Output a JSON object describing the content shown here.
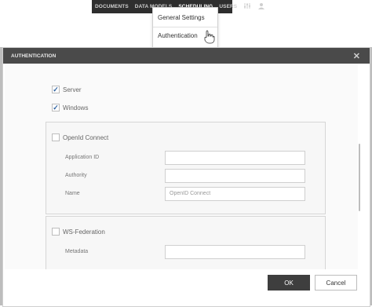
{
  "topnav": {
    "items": [
      "DOCUMENTS",
      "DATA MODELS",
      "SCHEDULING",
      "USERS"
    ],
    "active": "SCHEDULING",
    "icons": [
      "sliders-icon",
      "user-icon"
    ]
  },
  "dropdown": {
    "items": [
      "General Settings",
      "Authentication"
    ]
  },
  "modal": {
    "title": "AUTHENTICATION",
    "options": [
      {
        "label": "Server",
        "checked": true
      },
      {
        "label": "Windows",
        "checked": true
      }
    ],
    "openid": {
      "label": "OpenId Connect",
      "checked": false,
      "fields": [
        {
          "label": "Application ID",
          "value": ""
        },
        {
          "label": "Authority",
          "value": ""
        },
        {
          "label": "Name",
          "value": "OpenID Connect"
        }
      ]
    },
    "wsfed": {
      "label": "WS-Federation",
      "checked": false,
      "partial_label": "Metadata"
    },
    "buttons": {
      "ok": "OK",
      "cancel": "Cancel"
    }
  }
}
